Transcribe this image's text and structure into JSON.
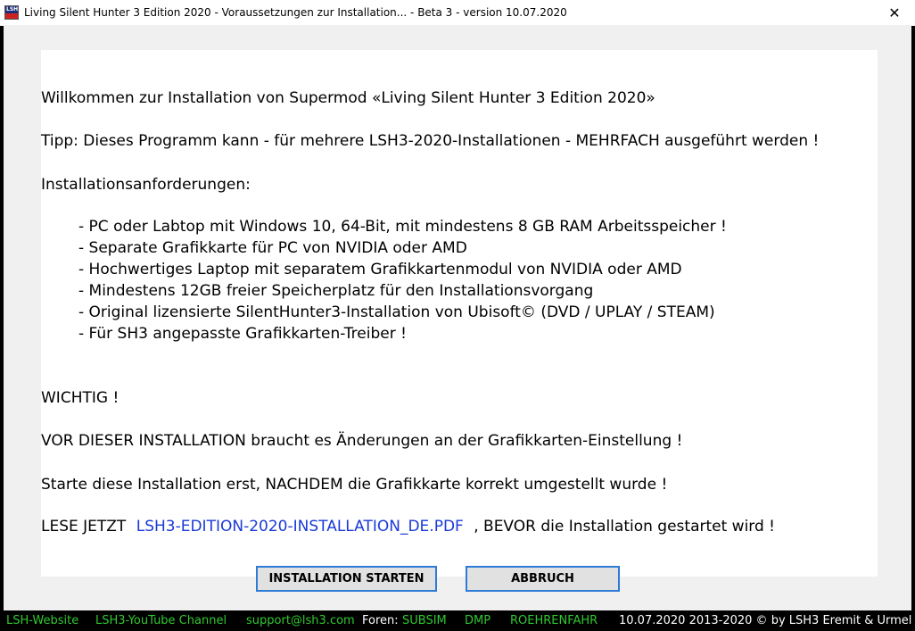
{
  "window": {
    "title": "Living Silent Hunter 3 Edition 2020 - Voraussetzungen zur Installation... - Beta 3 - version 10.07.2020",
    "icon": "lsh3-app-icon",
    "icon_text": "LSH",
    "close_glyph": "✕"
  },
  "content": {
    "welcome": "Willkommen zur Installation von Supermod «Living Silent Hunter 3 Edition 2020»",
    "tip": "Tipp: Dieses Programm kann - für mehrere LSH3-2020-Installationen - MEHRFACH ausgeführt werden !",
    "requirements_heading": "Installationsanforderungen:",
    "requirements": [
      "- PC oder Labtop mit Windows 10, 64-Bit, mit mindestens 8 GB RAM Arbeitsspeicher !",
      "- Separate Grafikkarte für PC von NVIDIA oder AMD",
      "- Hochwertiges Laptop mit separatem Grafikkartenmodul von NVIDIA oder AMD",
      "- Mindestens 12GB freier Speicherplatz für den Installationsvorgang",
      "- Original lizensierte SilentHunter3-Installation von Ubisoft© (DVD / UPLAY / STEAM)",
      "- Für SH3 angepasste Grafikkarten-Treiber !"
    ],
    "important": "WICHTIG !",
    "warning": "VOR DIESER INSTALLATION braucht es Änderungen an der Grafikkarten-Einstellung !",
    "start_after": "Starte diese Installation erst, NACHDEM die Grafikkarte korrekt umgestellt wurde !",
    "read_prefix": "LESE JETZT",
    "pdf_link": "LSH3-EDITION-2020-INSTALLATION_DE.PDF",
    "read_suffix": ", BEVOR die Installation gestartet wird !"
  },
  "buttons": {
    "start": "INSTALLATION STARTEN",
    "cancel": "ABBRUCH"
  },
  "footer": {
    "website": "LSH-Website",
    "youtube": "LSH3-YouTube Channel",
    "email": "support@lsh3.com",
    "forums_label": "Foren:",
    "forum_subsim": "SUBSIM",
    "forum_dmp": "DMP",
    "forum_roehrenfahr": "ROEHRENFAHR",
    "copyright": "10.07.2020 2013-2020 © by LSH3 Eremit & Urmel"
  },
  "colors": {
    "link_blue": "#1a3ad6",
    "footer_green": "#31c831",
    "button_border": "#2e7bd6"
  }
}
